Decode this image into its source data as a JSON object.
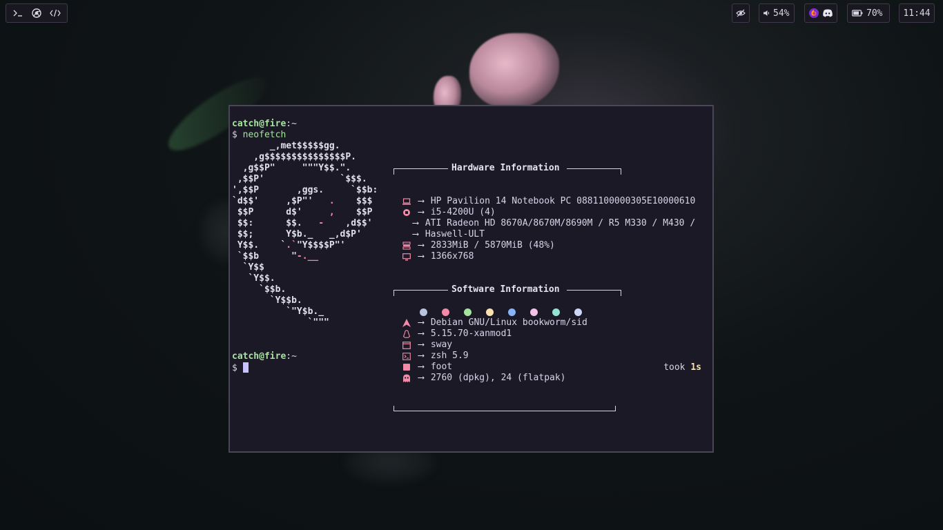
{
  "topbar": {
    "left_apps": [
      "terminal-icon",
      "chrome-icon",
      "code-icon"
    ],
    "eye_icon": "eye-slash-icon",
    "volume": "54%",
    "tray_icons": [
      "firefox-icon",
      "discord-icon"
    ],
    "battery": "70%",
    "clock": "11:44"
  },
  "terminal": {
    "prompt_user": "catch@fire",
    "prompt_cwd": ":~",
    "prompt_symbol": "$",
    "command": "neofetch",
    "ascii_lines": [
      "       _,met$$$$$gg.",
      "    ,g$$$$$$$$$$$$$$$P.",
      "  ,g$$P\"     \"\"\"Y$$.\".",
      " ,$$P'              `$$$.",
      "',$$P       ,ggs.     `$$b:",
      "`d$$'     ,$P\"'   .    $$$",
      " $$P      d$'     ,    $$P",
      " $$:      $$.   -    ,d$$'",
      " $$;      Y$b._   _,d$P'",
      " Y$$.    `.`\"Y$$$$P\"'",
      " `$$b      \"-.__",
      "  `Y$$",
      "   `Y$$.",
      "     `$$b.",
      "       `Y$$b.",
      "          `\"Y$b._",
      "              `\"\"\""
    ],
    "hardware_title": "Hardware Information",
    "hardware": [
      {
        "icon": "laptop-icon",
        "value": "HP Pavilion 14 Notebook PC 0881100000305E10000610"
      },
      {
        "icon": "cpu-icon",
        "value": "i5-4200U (4)"
      },
      {
        "icon": "",
        "value": "ATI Radeon HD 8670A/8670M/8690M / R5 M330 / M430 /"
      },
      {
        "icon": "",
        "value": "Haswell-ULT"
      },
      {
        "icon": "memory-icon",
        "value": "2833MiB / 5870MiB (48%)"
      },
      {
        "icon": "monitor-icon",
        "value": "1366x768"
      }
    ],
    "software_title": "Software Information",
    "software": [
      {
        "icon": "arch-icon",
        "value": "Debian GNU/Linux bookworm/sid"
      },
      {
        "icon": "linux-icon",
        "value": "5.15.70-xanmod1"
      },
      {
        "icon": "window-icon",
        "value": "sway"
      },
      {
        "icon": "shell-icon",
        "value": "zsh 5.9"
      },
      {
        "icon": "terminal-square-icon",
        "value": "foot"
      },
      {
        "icon": "ghost-icon",
        "value": "2760 (dpkg), 24 (flatpak)"
      }
    ],
    "arrow": "⟶",
    "palette": [
      "#bac2de",
      "#f38ba8",
      "#a6e3a1",
      "#f9e2af",
      "#89b4fa",
      "#f5c2e7",
      "#94e2d5",
      "#cdd6f4"
    ],
    "took_label": "took",
    "took_value": "1s"
  }
}
